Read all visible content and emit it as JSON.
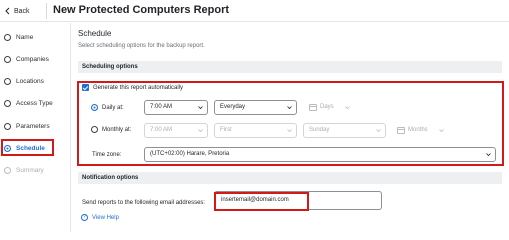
{
  "header": {
    "back_label": "Back",
    "title": "New Protected Computers Report"
  },
  "sidebar": {
    "steps": [
      {
        "label": "Name",
        "state": "default"
      },
      {
        "label": "Companies",
        "state": "default"
      },
      {
        "label": "Locations",
        "state": "default"
      },
      {
        "label": "Access Type",
        "state": "default"
      },
      {
        "label": "Parameters",
        "state": "default"
      },
      {
        "label": "Schedule",
        "state": "active"
      },
      {
        "label": "Summary",
        "state": "disabled"
      }
    ]
  },
  "schedule": {
    "title": "Schedule",
    "description": "Select scheduling options for the backup report.",
    "options_header": "Scheduling options",
    "auto_generate_label": "Generate this report automatically",
    "auto_generate_checked": true,
    "daily": {
      "label": "Daily at:",
      "selected": true,
      "time": "7:00 AM",
      "frequency": "Everyday",
      "unit_label": "Days"
    },
    "monthly": {
      "label": "Monthly at:",
      "selected": false,
      "time": "7:00 AM",
      "week": "First",
      "day": "Sunday",
      "unit_label": "Months"
    },
    "timezone_label": "Time zone:",
    "timezone": "(UTC+02:00) Harare, Pretoria"
  },
  "notification": {
    "header": "Notification options",
    "email_label": "Send reports to the following email addresses:",
    "email_value": "insertemail@domain.com",
    "help_label": "View Help"
  },
  "colors": {
    "accent": "#1f6fd6",
    "highlight": "#d11a1a"
  }
}
